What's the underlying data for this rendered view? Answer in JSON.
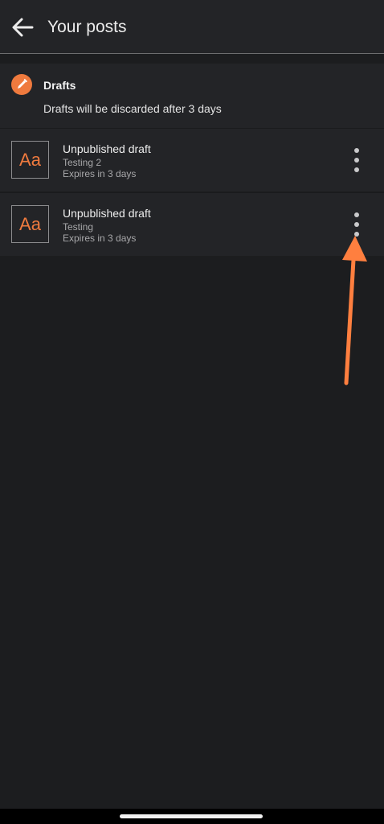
{
  "header": {
    "title": "Your posts",
    "back_icon": "arrow-left-icon"
  },
  "drafts": {
    "icon": "pencil-icon",
    "title": "Drafts",
    "subtitle": "Drafts will be discarded after 3 days",
    "items": [
      {
        "thumb_text": "Aa",
        "title": "Unpublished draft",
        "name": "Testing 2",
        "expiry": "Expires in 3 days",
        "menu_icon": "more-vertical-icon"
      },
      {
        "thumb_text": "Aa",
        "title": "Unpublished draft",
        "name": "Testing",
        "expiry": "Expires in 3 days",
        "menu_icon": "more-vertical-icon"
      }
    ]
  },
  "colors": {
    "accent": "#ef7a3e",
    "background": "#1c1d1f",
    "surface": "#232427",
    "annotation_arrow": "#ff7f3f"
  }
}
